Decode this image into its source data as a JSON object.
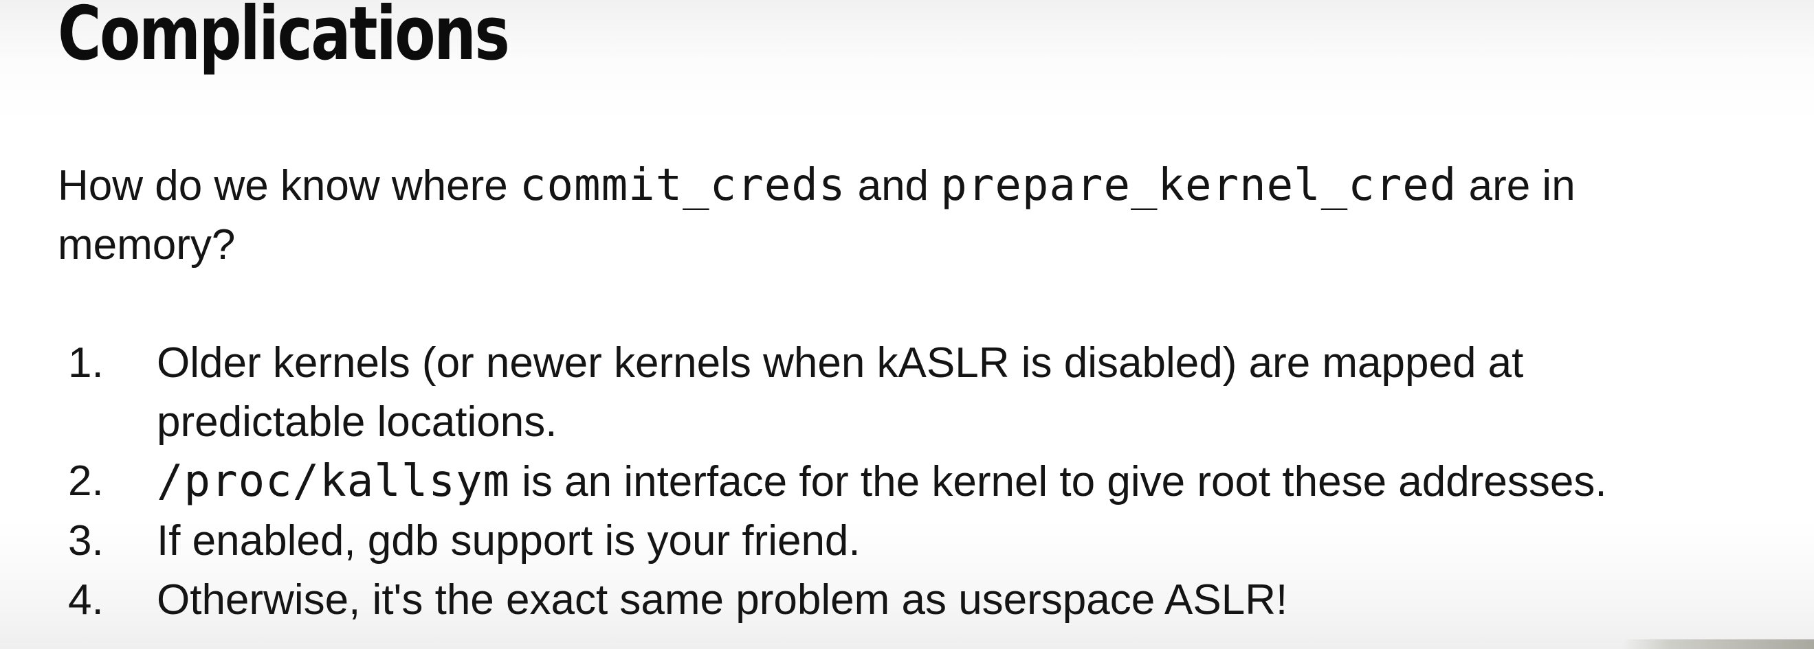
{
  "slide": {
    "title": "Complications",
    "intro": {
      "before": "How do we know where ",
      "code1": "commit_creds",
      "between": " and ",
      "code2": "prepare_kernel_cred",
      "after_line1": " are in",
      "line2": "memory?"
    },
    "items": [
      {
        "number": "1.",
        "text_line1": "Older kernels (or newer kernels when kASLR is disabled) are mapped at",
        "text_line2": "predictable locations."
      },
      {
        "number": "2.",
        "code": "/proc/kallsym",
        "text": " is an interface for the kernel to give root these addresses."
      },
      {
        "number": "3.",
        "text": "If enabled, gdb support is your friend."
      },
      {
        "number": "4.",
        "text": "Otherwise, it's the exact same problem as userspace ASLR!"
      }
    ]
  }
}
